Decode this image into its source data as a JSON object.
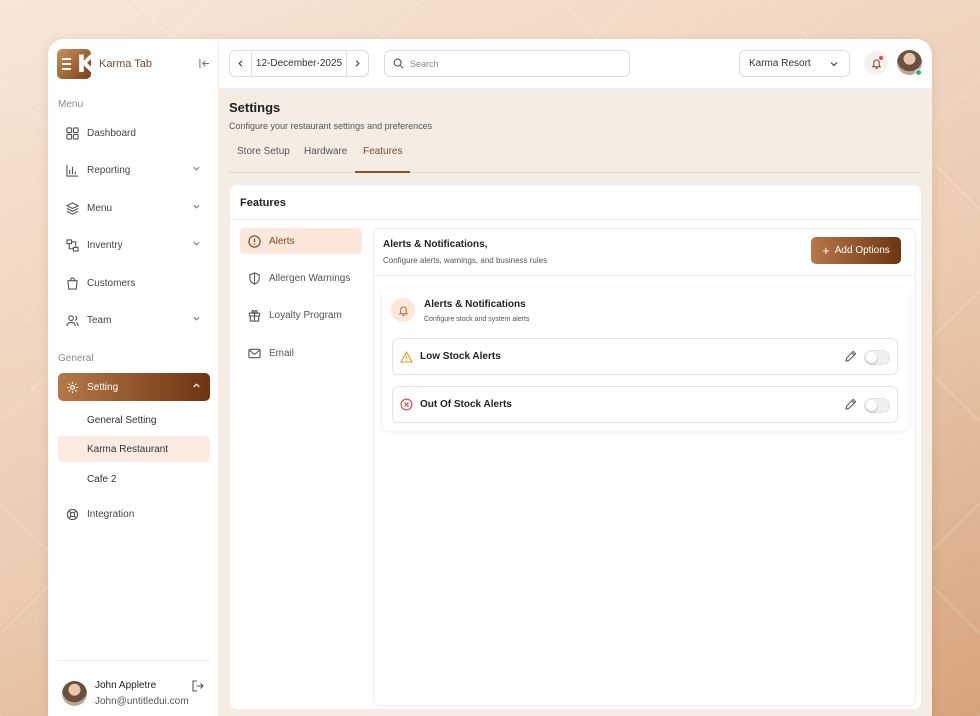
{
  "brand": {
    "name": "Karma Tab"
  },
  "sidebar": {
    "menu_label": "Menu",
    "general_label": "General",
    "items": [
      {
        "label": "Dashboard"
      },
      {
        "label": "Reporting"
      },
      {
        "label": "Menu"
      },
      {
        "label": "Inventry"
      },
      {
        "label": "Customers"
      },
      {
        "label": "Team"
      }
    ],
    "setting": {
      "label": "Setting"
    },
    "sub_items": [
      {
        "label": "General Setting"
      },
      {
        "label": "Karma Restaurant"
      },
      {
        "label": "Cafe 2"
      }
    ],
    "integration": {
      "label": "Integration"
    }
  },
  "profile": {
    "name": "John Appletre",
    "email": "John@untitledui.com"
  },
  "topbar": {
    "date": "12-December-2025",
    "search_placeholder": "Search",
    "location": "Karma Resort"
  },
  "page": {
    "title": "Settings",
    "subtitle": "Configure your restaurant settings and preferences",
    "tabs": [
      {
        "label": "Store Setup"
      },
      {
        "label": "Hardware"
      },
      {
        "label": "Features"
      }
    ]
  },
  "features": {
    "title": "Features",
    "nav": [
      {
        "label": "Alerts"
      },
      {
        "label": "Allergen Warnings"
      },
      {
        "label": "Loyalty Program"
      },
      {
        "label": "Email"
      }
    ],
    "panel": {
      "title": "Alerts & Notifications,",
      "subtitle": "Configure alerts, warnings, and business rules",
      "add_button": "Add Options",
      "inner": {
        "title": "Alerts & Notifications",
        "subtitle": "Configure stock and system alerts",
        "alerts": [
          {
            "label": "Low Stock Alerts",
            "enabled": false
          },
          {
            "label": "Out Of Stock Alerts",
            "enabled": false
          }
        ]
      }
    }
  },
  "colors": {
    "accent": "#8a5430",
    "accent_light": "#fbe8da",
    "warning": "#e0a82e",
    "error": "#d9534f",
    "online": "#2fb463"
  }
}
